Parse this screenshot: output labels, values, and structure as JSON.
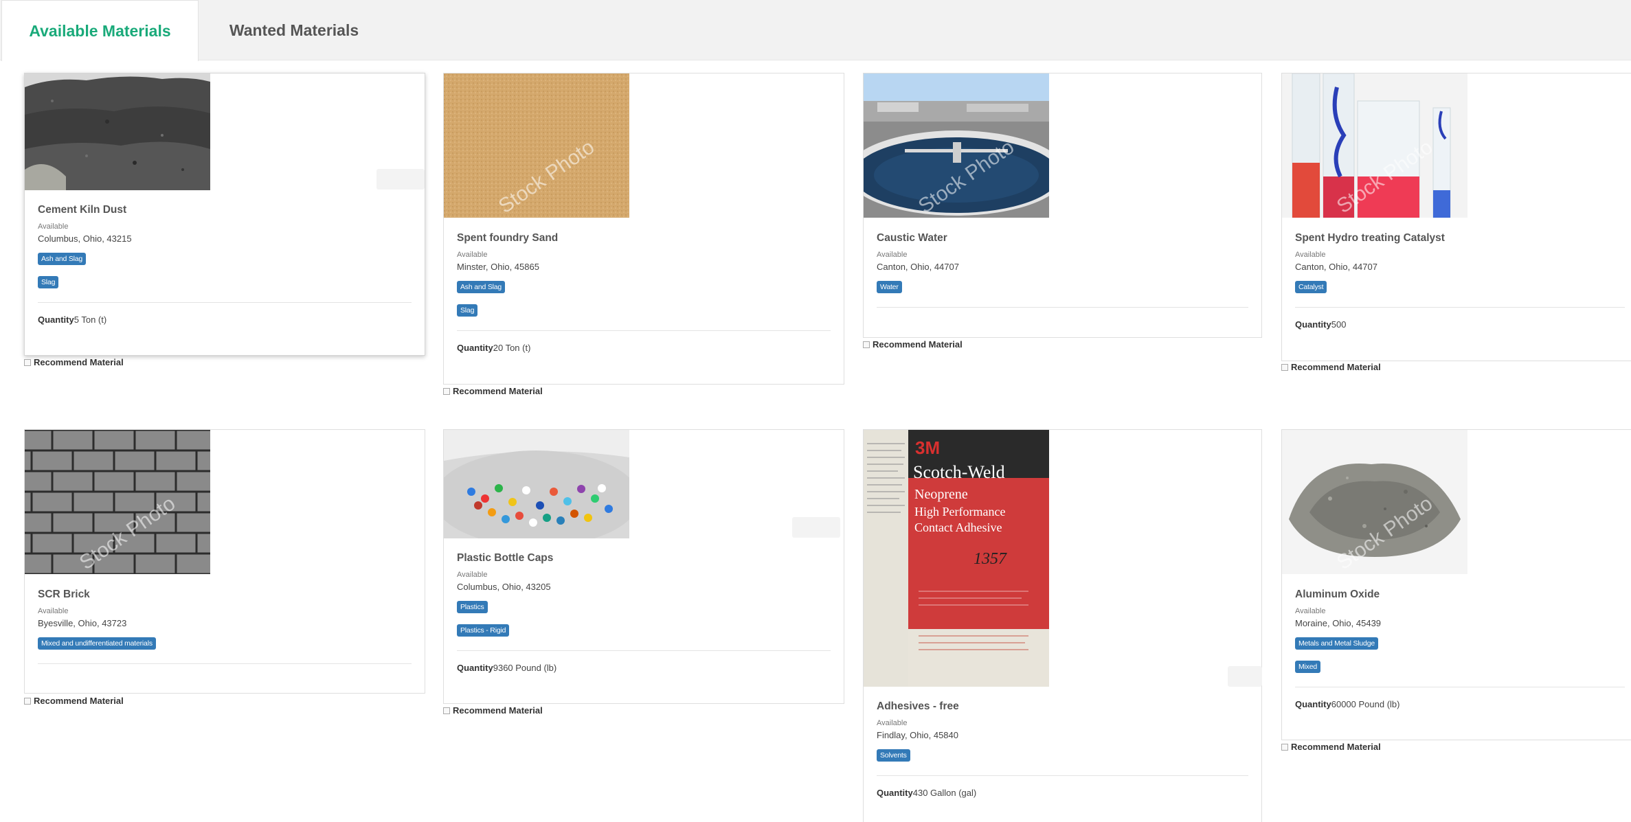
{
  "tabs": {
    "available": "Available Materials",
    "wanted": "Wanted Materials"
  },
  "colors": {
    "accent": "#1aaa7a",
    "tag": "#337ab7"
  },
  "recommend_label": "Recommend Material",
  "quantity_label": "Quantity",
  "materials": [
    {
      "title": "Cement Kiln Dust",
      "status": "Available",
      "location": "Columbus, Ohio, 43215",
      "tags": [
        "Ash and Slag",
        "Slag"
      ],
      "quantity": "5 Ton (t)",
      "image": "dark-gravel-pile"
    },
    {
      "title": "Spent foundry Sand",
      "status": "Available",
      "location": "Minster, Ohio, 45865",
      "tags": [
        "Ash and Slag",
        "Slag"
      ],
      "quantity": "20 Ton (t)",
      "image": "sand"
    },
    {
      "title": "Caustic Water",
      "status": "Available",
      "location": "Canton, Ohio, 44707",
      "tags": [
        "Water"
      ],
      "quantity": "",
      "image": "water-treatment-tank"
    },
    {
      "title": "Spent Hydro treating Catalyst",
      "status": "Available",
      "location": "Canton, Ohio, 44707",
      "tags": [
        "Catalyst"
      ],
      "quantity": "500",
      "image": "lab-cylinders"
    },
    {
      "title": "SCR Brick",
      "status": "Available",
      "location": "Byesville, Ohio, 43723",
      "tags": [
        "Mixed and undifferentiated materials"
      ],
      "quantity": "",
      "image": "brick-wall"
    },
    {
      "title": "Plastic Bottle Caps",
      "status": "Available",
      "location": "Columbus, Ohio, 43205",
      "tags": [
        "Plastics",
        "Plastics - Rigid"
      ],
      "quantity": "9360 Pound (lb)",
      "image": "bottle-caps"
    },
    {
      "title": "Adhesives - free",
      "status": "Available",
      "location": "Findlay, Ohio, 45840",
      "tags": [
        "Solvents"
      ],
      "quantity": "430 Gallon (gal)",
      "image": "adhesive-can",
      "can_label": {
        "brand": "3M",
        "product": "Scotch-Weld",
        "line1": "Neoprene",
        "line2": "High Performance",
        "line3": "Contact Adhesive",
        "code": "1357"
      }
    },
    {
      "title": "Aluminum Oxide",
      "status": "Available",
      "location": "Moraine, Ohio, 45439",
      "tags": [
        "Metals and Metal Sludge",
        "Mixed"
      ],
      "quantity": "60000 Pound (lb)",
      "image": "gray-powder"
    }
  ],
  "watermark": "Stock Photo"
}
